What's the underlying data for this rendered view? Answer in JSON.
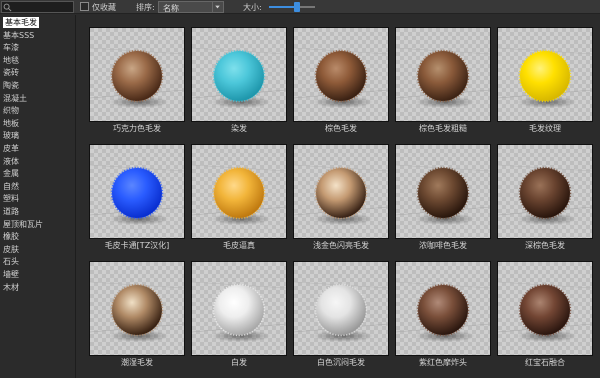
{
  "toolbar": {
    "search_value": "",
    "favorites_label": "仅收藏",
    "sort_label": "排序:",
    "sort_value": "名称",
    "size_label": "大小:",
    "size_level": 0.6
  },
  "sidebar": {
    "categories": [
      "基本毛发",
      "基本SSS",
      "车漆",
      "地毯",
      "瓷砖",
      "陶瓷",
      "混凝土",
      "织物",
      "地板",
      "玻璃",
      "皮革",
      "液体",
      "金属",
      "自然",
      "塑料",
      "道路",
      "屋顶和瓦片",
      "橡胶",
      "皮肤",
      "石头",
      "墙壁",
      "木材"
    ],
    "active_index": 0
  },
  "materials": [
    {
      "name": "巧克力色毛发",
      "color": "#4a2a18",
      "highlight": "#9a6a48",
      "tip": "#c9a686"
    },
    {
      "name": "染发",
      "color": "#1f97ac",
      "highlight": "#4cc7da",
      "tip": "#7ee0ec"
    },
    {
      "name": "棕色毛发",
      "color": "#3b2214",
      "highlight": "#8e5a38",
      "tip": "#b98b6a"
    },
    {
      "name": "棕色毛发粗糙",
      "color": "#3e2415",
      "highlight": "#8a5a3a",
      "tip": "#b5906e"
    },
    {
      "name": "毛发纹理",
      "color": "#d8b800",
      "highlight": "#ffe000",
      "tip": "#fff27a"
    },
    {
      "name": "毛皮卡通[TZ汉化]",
      "color": "#0a2fd0",
      "highlight": "#2a5cff",
      "tip": "#5b86ff"
    },
    {
      "name": "毛皮逼真",
      "color": "#c07a10",
      "highlight": "#f2b53a",
      "tip": "#ffd98a"
    },
    {
      "name": "浅金色闪亮毛发",
      "color": "#3a2417",
      "highlight": "#c49a72",
      "tip": "#f4e2c8"
    },
    {
      "name": "浓咖啡色毛发",
      "color": "#2a170d",
      "highlight": "#6e4a32",
      "tip": "#a07a5c"
    },
    {
      "name": "深棕色毛发",
      "color": "#2a160d",
      "highlight": "#6a4430",
      "tip": "#9a7258"
    },
    {
      "name": "潮湿毛发",
      "color": "#3a2314",
      "highlight": "#b08a66",
      "tip": "#f0e0c6"
    },
    {
      "name": "白发",
      "color": "#a9a9a9",
      "highlight": "#eeeeee",
      "tip": "#ffffff"
    },
    {
      "name": "白色沉闷毛发",
      "color": "#9a9a9a",
      "highlight": "#e4e4e4",
      "tip": "#f6f6f6"
    },
    {
      "name": "紫红色摩炸头",
      "color": "#2c1810",
      "highlight": "#7a4f3a",
      "tip": "#b08a78"
    },
    {
      "name": "红宝石融合",
      "color": "#2c1710",
      "highlight": "#734634",
      "tip": "#ab8470"
    }
  ],
  "colors": {
    "accent": "#3d8ee0",
    "background": "#2b2b2b",
    "toolbar": "#383838",
    "thumb_bg": "#c8c8c8"
  }
}
